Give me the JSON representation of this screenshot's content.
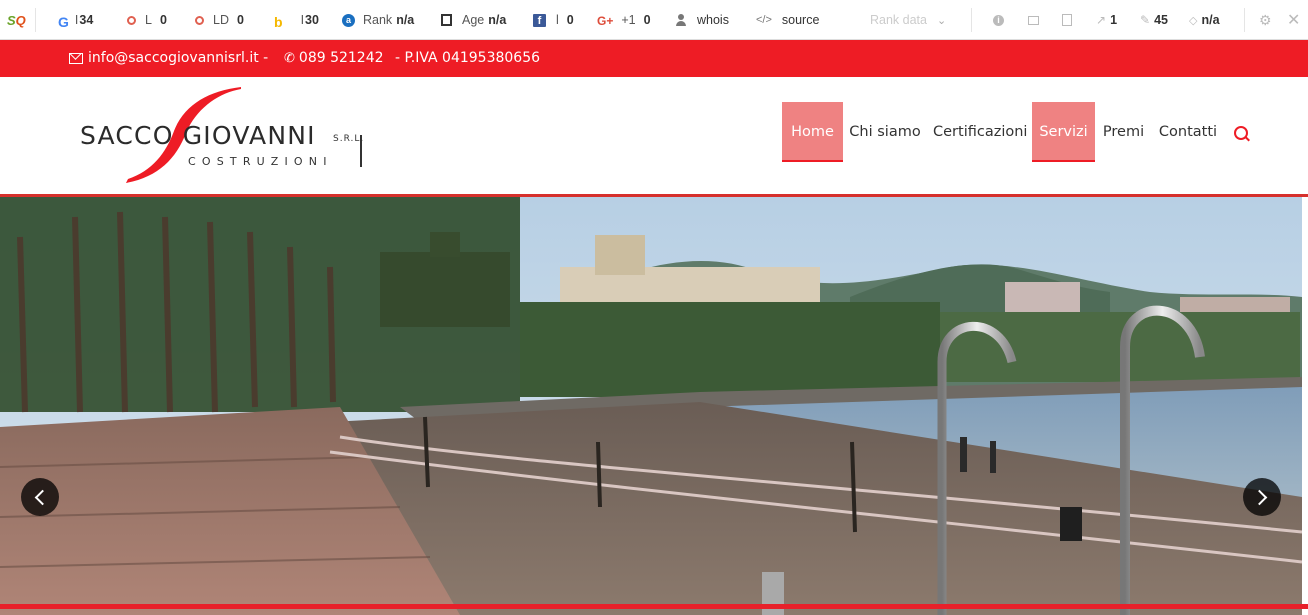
{
  "seo_toolbar": {
    "logo_text_1": "S",
    "logo_text_2": "Q",
    "items": [
      {
        "icon": "google-icon",
        "glyph": "G",
        "label": "I",
        "value": "34"
      },
      {
        "icon": "links-ring-icon",
        "label": "L",
        "value": "0"
      },
      {
        "icon": "linking-domains-ring-icon",
        "label": "LD",
        "value": "0"
      },
      {
        "icon": "bing-icon",
        "glyph": "b",
        "label": "I",
        "value": "30"
      },
      {
        "icon": "alexa-icon",
        "glyph": "a",
        "label": "Rank",
        "value": "n/a"
      },
      {
        "icon": "calendar-icon",
        "label": "Age",
        "value": "n/a"
      },
      {
        "icon": "facebook-icon",
        "glyph": "f",
        "label": "l",
        "value": "0"
      },
      {
        "icon": "google-plus-icon",
        "glyph": "G+",
        "label": "+1",
        "value": "0"
      },
      {
        "icon": "user-icon",
        "label": "whois"
      },
      {
        "icon": "code-icon",
        "glyph": "</>",
        "label": "source"
      }
    ],
    "faded_label": "Rank data",
    "right": [
      {
        "icon": "info-icon"
      },
      {
        "icon": "monitor-icon"
      },
      {
        "icon": "page-icon"
      },
      {
        "icon": "external-links-icon",
        "value": "1"
      },
      {
        "icon": "internal-links-icon",
        "value": "45"
      },
      {
        "icon": "diamond-icon",
        "value": "n/a"
      },
      {
        "icon": "gear-icon"
      },
      {
        "icon": "close-icon"
      }
    ]
  },
  "topbar": {
    "email": "info@saccogiovannisrl.it -",
    "phone": "089 521242",
    "vat": "- P.IVA 04195380656",
    "bg_color": "#ee1c25"
  },
  "logo": {
    "name": "SACCO GIOVANNI",
    "srl": "S.R.L.",
    "subtitle": "COSTRUZIONI"
  },
  "nav": {
    "items": [
      "Home",
      "Chi siamo",
      "Certificazioni",
      "Servizi",
      "Premi",
      "Contatti"
    ],
    "active": [
      "Home",
      "Servizi"
    ],
    "accent": "#ef8282"
  },
  "slider": {
    "prev_label": "",
    "next_label": ""
  }
}
